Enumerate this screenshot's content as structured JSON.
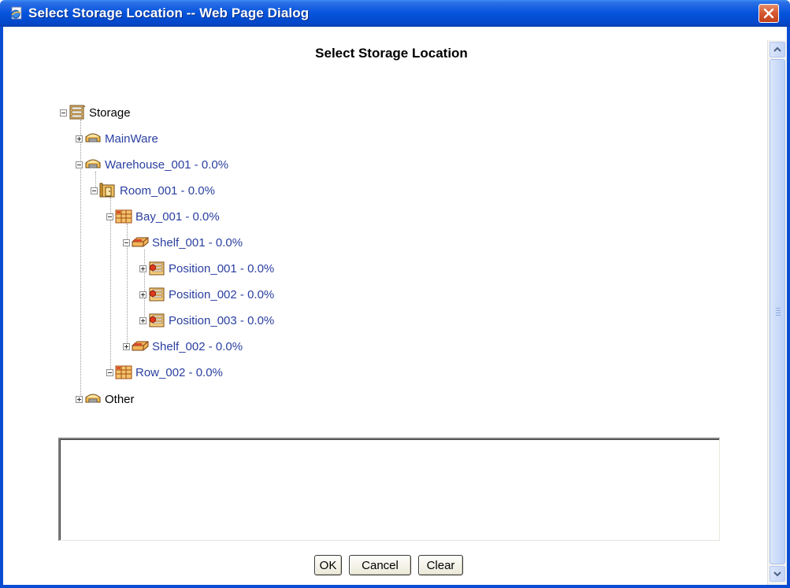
{
  "window": {
    "title": "Select Storage Location -- Web Page Dialog"
  },
  "page": {
    "heading": "Select Storage Location"
  },
  "tree": {
    "root": "Storage",
    "mainware": "MainWare",
    "warehouse": "Warehouse_001 - 0.0%",
    "room": "Room_001 - 0.0%",
    "bay": "Bay_001 - 0.0%",
    "shelf1": "Shelf_001 - 0.0%",
    "position1": "Position_001 - 0.0%",
    "position2": "Position_002 - 0.0%",
    "position3": "Position_003 - 0.0%",
    "shelf2": "Shelf_002 - 0.0%",
    "row": "Row_002 - 0.0%",
    "other": "Other"
  },
  "notes": {
    "value": ""
  },
  "buttons": {
    "ok": "OK",
    "cancel": "Cancel",
    "clear": "Clear"
  },
  "colors": {
    "titlebar": "#0553dc",
    "link": "#2a3fa0",
    "close": "#d75a33"
  }
}
